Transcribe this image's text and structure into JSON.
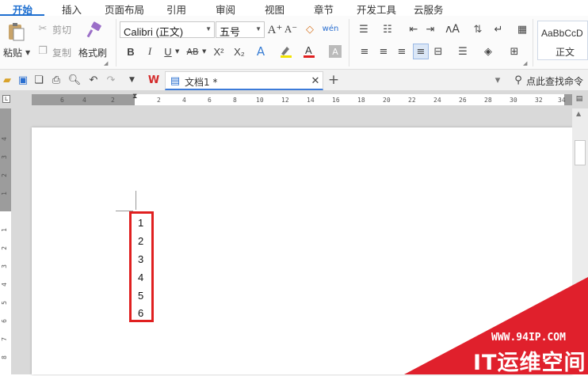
{
  "menubar": {
    "tabs": [
      "开始",
      "插入",
      "页面布局",
      "引用",
      "审阅",
      "视图",
      "章节",
      "开发工具",
      "云服务"
    ],
    "active_tab": "开始"
  },
  "ribbon": {
    "clipboard": {
      "paste": "粘贴",
      "cut": "剪切",
      "copy": "复制",
      "format_painter": "格式刷"
    },
    "font": {
      "family": "Calibri (正文)",
      "size": "五号",
      "bold": "B",
      "italic": "I",
      "underline": "U",
      "strikethrough": "AB",
      "superscript": "X²",
      "subscript": "X₂"
    },
    "styles": {
      "preview": "AaBbCcD",
      "name": "正文"
    }
  },
  "quickbar": {
    "document_tab": "文档1 *",
    "search": "点此查找命令"
  },
  "ruler": {
    "horizontal_ticks": [
      "6",
      "4",
      "2",
      "2",
      "4",
      "6",
      "8",
      "10",
      "12",
      "14",
      "16",
      "18",
      "20",
      "22",
      "24",
      "26",
      "28",
      "30",
      "32",
      "34"
    ],
    "vertical_ticks": [
      "4",
      "3",
      "2",
      "1",
      "1",
      "2",
      "3",
      "4",
      "5",
      "6",
      "7",
      "8"
    ]
  },
  "document": {
    "lines": [
      "1",
      "2",
      "3",
      "4",
      "5",
      "6"
    ],
    "highlight_color": "#e02020"
  },
  "watermark": {
    "url": "WWW.94IP.COM",
    "title": "IT运维空间",
    "color": "#e0202c"
  }
}
